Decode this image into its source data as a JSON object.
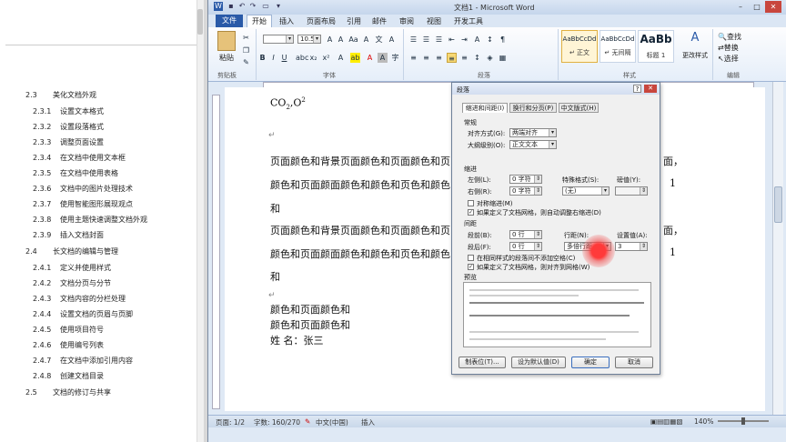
{
  "toc": {
    "sections": [
      {
        "num": "2.3",
        "label": "美化文档外观"
      },
      {
        "num": "2.4",
        "label": "长文档的编辑与管理"
      },
      {
        "num": "2.5",
        "label": "文档的修订与共享"
      }
    ],
    "items_a": [
      {
        "num": "2.3.1",
        "label": "设置文本格式"
      },
      {
        "num": "2.3.2",
        "label": "设置段落格式"
      },
      {
        "num": "2.3.3",
        "label": "调整页面设置"
      },
      {
        "num": "2.3.4",
        "label": "在文档中使用文本框"
      },
      {
        "num": "2.3.5",
        "label": "在文档中使用表格"
      },
      {
        "num": "2.3.6",
        "label": "文档中的图片处理技术"
      },
      {
        "num": "2.3.7",
        "label": "使用智能图形展现观点"
      },
      {
        "num": "2.3.8",
        "label": "使用主题快速调整文档外观"
      },
      {
        "num": "2.3.9",
        "label": "插入文档封面"
      }
    ],
    "items_b": [
      {
        "num": "2.4.1",
        "label": "定义并使用样式"
      },
      {
        "num": "2.4.2",
        "label": "文档分页与分节"
      },
      {
        "num": "2.4.3",
        "label": "文档内容的分栏处理"
      },
      {
        "num": "2.4.4",
        "label": "设置文档的页眉与页脚"
      },
      {
        "num": "2.4.5",
        "label": "使用项目符号"
      },
      {
        "num": "2.4.6",
        "label": "使用编号列表"
      },
      {
        "num": "2.4.7",
        "label": "在文档中添加引用内容"
      },
      {
        "num": "2.4.8",
        "label": "创建文档目录"
      }
    ]
  },
  "window": {
    "title": "文档1 - Microsoft Word",
    "tabs": [
      "文件",
      "开始",
      "插入",
      "页面布局",
      "引用",
      "邮件",
      "审阅",
      "视图",
      "开发工具"
    ],
    "font_size": "10.5",
    "group_labels": {
      "clipboard": "剪贴板",
      "font": "字体",
      "paragraph": "段落",
      "styles": "样式",
      "editing": "编辑"
    },
    "paste_label": "粘贴",
    "styles": [
      {
        "sample": "AaBbCcDd",
        "label": "↵ 正文"
      },
      {
        "sample": "AaBbCcDd",
        "label": "↵ 无间隔"
      },
      {
        "sample": "AaBb",
        "label": "标题 1"
      }
    ],
    "change_styles": "更改样式",
    "editing": [
      "查找",
      "替换",
      "选择"
    ]
  },
  "document": {
    "formula": "CO2,O2",
    "line1": "页面颜色和背景页面颜色和页面颜色和页",
    "line2": "颜色和页面颜面颜色和颜色和页色和颜色",
    "line3": "和",
    "line4": "页面颜色和背景页面颜色和页面颜色和页",
    "line5": "颜色和页面颜面颜色和颜色和页色和颜色",
    "line6": "和",
    "line7": "颜色和页面颜色和",
    "line8": "颜色和页面颜色和",
    "line9": "姓 名：张三",
    "right_frag1": "面，",
    "right_frag2": "1",
    "right_frag3": "面，",
    "right_frag4": "1"
  },
  "status": {
    "page": "页面: 1/2",
    "words": "字数: 160/270",
    "lang": "中文(中国)",
    "mode": "插入",
    "zoom": "140%"
  },
  "dialog": {
    "title": "段落",
    "tabs": [
      "缩进和间距(I)",
      "换行和分页(P)",
      "中文版式(H)"
    ],
    "general": "常规",
    "align_label": "对齐方式(G):",
    "align_value": "两端对齐",
    "outline_label": "大纲级别(O):",
    "outline_value": "正文文本",
    "indent": "缩进",
    "left_label": "左侧(L):",
    "left_value": "0 字符",
    "right_label": "右侧(R):",
    "right_value": "0 字符",
    "special_label": "特殊格式(S):",
    "special_value": "(无)",
    "by_label": "磅值(Y):",
    "mirror": "对称缩进(M)",
    "auto_indent": "如果定义了文档网格，则自动调整右缩进(D)",
    "spacing": "间距",
    "before_label": "段前(B):",
    "before_value": "0 行",
    "after_label": "段后(F):",
    "after_value": "0 行",
    "line_label": "行距(N):",
    "line_value": "多倍行距",
    "at_label": "设置值(A):",
    "at_value": "3",
    "no_space": "在相同样式的段落间不添加空格(C)",
    "snap_grid": "如果定义了文档网格，则对齐到网格(W)",
    "preview": "预览",
    "btn_tabs": "制表位(T)...",
    "btn_default": "设为默认值(D)",
    "btn_ok": "确定",
    "btn_cancel": "取消"
  }
}
